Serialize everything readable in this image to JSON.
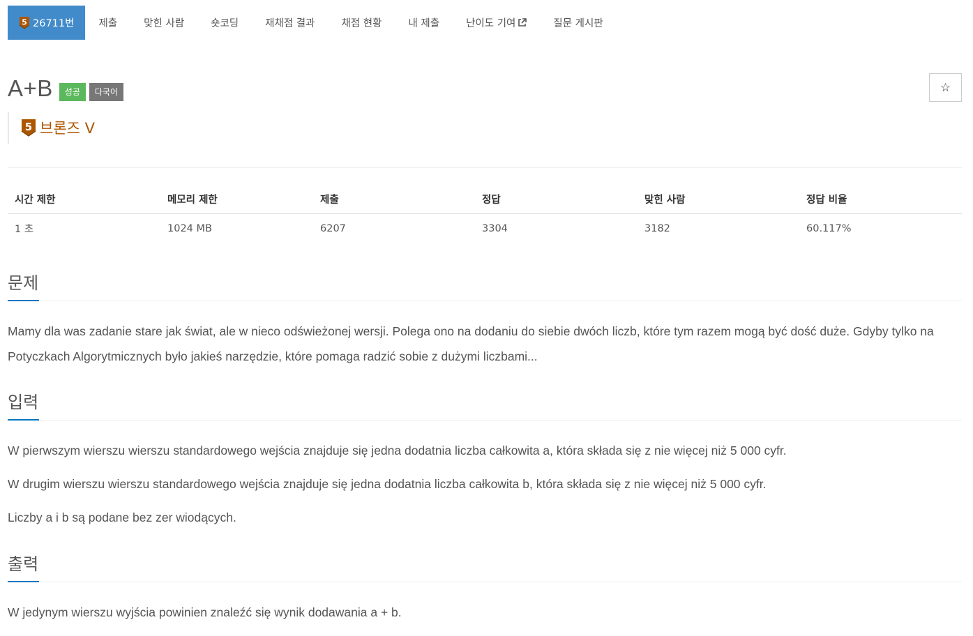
{
  "nav": {
    "problem_number": "26711번",
    "tier_digit": "5",
    "items": [
      {
        "label": "제출"
      },
      {
        "label": "맞힌 사람"
      },
      {
        "label": "숏코딩"
      },
      {
        "label": "재채점 결과"
      },
      {
        "label": "채점 현황"
      },
      {
        "label": "내 제출"
      },
      {
        "label": "난이도 기여"
      },
      {
        "label": "질문 게시판"
      }
    ],
    "external_icon": "external-link-icon"
  },
  "problem": {
    "title": "A+B",
    "badges": [
      "성공",
      "다국어"
    ],
    "star_icon": "☆",
    "tier": {
      "digit": "5",
      "name": "브론즈 V",
      "color": "#ad5600"
    }
  },
  "info": {
    "headers": [
      "시간 제한",
      "메모리 제한",
      "제출",
      "정답",
      "맞힌 사람",
      "정답 비율"
    ],
    "values": [
      "1 초",
      "1024 MB",
      "6207",
      "3304",
      "3182",
      "60.117%"
    ]
  },
  "sections": {
    "problem": {
      "heading": "문제",
      "paragraphs": [
        "Mamy dla was zadanie stare jak świat, ale w nieco odświeżonej wersji. Polega ono na dodaniu do siebie dwóch liczb, które tym razem mogą być dość duże. Gdyby tylko na Potyczkach Algorytmicznych było jakieś narzędzie, które pomaga radzić sobie z dużymi liczbami..."
      ]
    },
    "input": {
      "heading": "입력",
      "paragraphs": [
        "W pierwszym wierszu wierszu standardowego wejścia znajduje się jedna dodatnia liczba całkowita a, która składa się z nie więcej niż 5 000 cyfr.",
        "W drugim wierszu wierszu standardowego wejścia znajduje się jedna dodatnia liczba całkowita b, która składa się z nie więcej niż 5 000 cyfr.",
        "Liczby a i b są podane bez zer wiodących."
      ]
    },
    "output": {
      "heading": "출력",
      "paragraphs": [
        "W jedynym wierszu wyjścia powinien znaleźć się wynik dodawania a + b."
      ]
    }
  },
  "colors": {
    "nav_active": "#428bca",
    "success": "#5cb85c",
    "default": "#777777",
    "bronze": "#ad5600",
    "heading_underline": "#0076c0"
  }
}
